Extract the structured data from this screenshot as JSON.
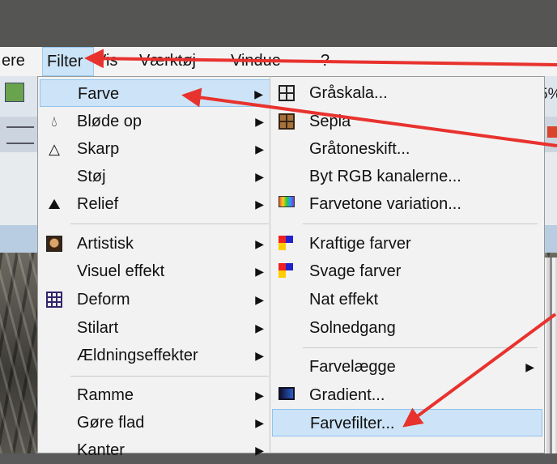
{
  "menubar": {
    "items": [
      {
        "label": "ere"
      },
      {
        "label": "Filter"
      },
      {
        "label": "Vis"
      },
      {
        "label": "Værktøj"
      },
      {
        "label": "Vindue"
      },
      {
        "label": "?"
      }
    ]
  },
  "toolbar": {
    "zoom_fragment": "5%"
  },
  "filter_menu": {
    "items": [
      {
        "label": "Farve",
        "icon": "none"
      },
      {
        "label": "Bløde op",
        "icon": "drop-icon"
      },
      {
        "label": "Skarp",
        "icon": "triangle-icon"
      },
      {
        "label": "Støj",
        "icon": "none"
      },
      {
        "label": "Relief",
        "icon": "relief-icon"
      },
      {
        "label": "Artistisk",
        "icon": "portrait-icon"
      },
      {
        "label": "Visuel effekt",
        "icon": "none"
      },
      {
        "label": "Deform",
        "icon": "deform-icon"
      },
      {
        "label": "Stilart",
        "icon": "none"
      },
      {
        "label": "Ældningseffekter",
        "icon": "none"
      },
      {
        "label": "Ramme",
        "icon": "none"
      },
      {
        "label": "Gøre flad",
        "icon": "none"
      },
      {
        "label": "Kanter",
        "icon": "none"
      }
    ]
  },
  "farve_submenu": {
    "items": [
      {
        "label": "Gråskala...",
        "icon": "grid-icon"
      },
      {
        "label": "Sepia",
        "icon": "sepia-icon"
      },
      {
        "label": "Gråtoneskift...",
        "icon": "none"
      },
      {
        "label": "Byt RGB kanalerne...",
        "icon": "none"
      },
      {
        "label": "Farvetone variation...",
        "icon": "rainbow-icon"
      },
      {
        "label": "Kraftige farver",
        "icon": "vivid-colors-icon"
      },
      {
        "label": "Svage farver",
        "icon": "pale-colors-icon"
      },
      {
        "label": "Nat effekt",
        "icon": "none"
      },
      {
        "label": "Solnedgang",
        "icon": "none"
      },
      {
        "label": "Farvelægge",
        "icon": "none"
      },
      {
        "label": "Gradient...",
        "icon": "gradient-icon"
      },
      {
        "label": "Farvefilter...",
        "icon": "none"
      }
    ]
  },
  "colors": {
    "highlight": "#cde4f8",
    "annotation_arrow": "#e8322e"
  }
}
